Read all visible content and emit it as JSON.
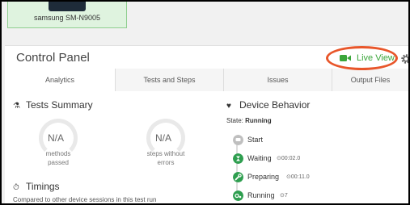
{
  "device": {
    "name": "samsung SM-N9005"
  },
  "panel": {
    "title": "Control Panel",
    "live_view_label": "Live View",
    "icons": {
      "live_view": "video-camera-icon",
      "settings": "gear-icon"
    },
    "colors": {
      "accent": "#3aa63a",
      "highlight": "#e8562a"
    }
  },
  "tabs": [
    {
      "label": "Analytics",
      "active": true
    },
    {
      "label": "Tests and Steps",
      "active": false
    },
    {
      "label": "Issues",
      "active": false
    },
    {
      "label": "Output Files",
      "active": false
    }
  ],
  "tests_summary": {
    "title": "Tests Summary",
    "gauges": [
      {
        "value": "N/A",
        "caption_line1": "methods",
        "caption_line2": "passed"
      },
      {
        "value": "N/A",
        "caption_line1": "steps without",
        "caption_line2": "errors"
      }
    ]
  },
  "timings": {
    "title": "Timings",
    "note": "Compared to other device sessions in this test run"
  },
  "device_behavior": {
    "title": "Device Behavior",
    "state_label": "State:",
    "state_value": "Running",
    "steps": [
      {
        "label": "Start",
        "badge": "",
        "color": "#bfbfbf",
        "icon": "circle-icon"
      },
      {
        "label": "Waiting",
        "badge": "⊙00:02.0",
        "color": "#2e9e4f",
        "icon": "hourglass-icon"
      },
      {
        "label": "Preparing",
        "badge": "⊙00:11.0",
        "color": "#2e9e4f",
        "icon": "wrench-icon"
      },
      {
        "label": "Running",
        "badge": "⊙7",
        "color": "#2e9e4f",
        "icon": "gears-icon"
      }
    ]
  }
}
